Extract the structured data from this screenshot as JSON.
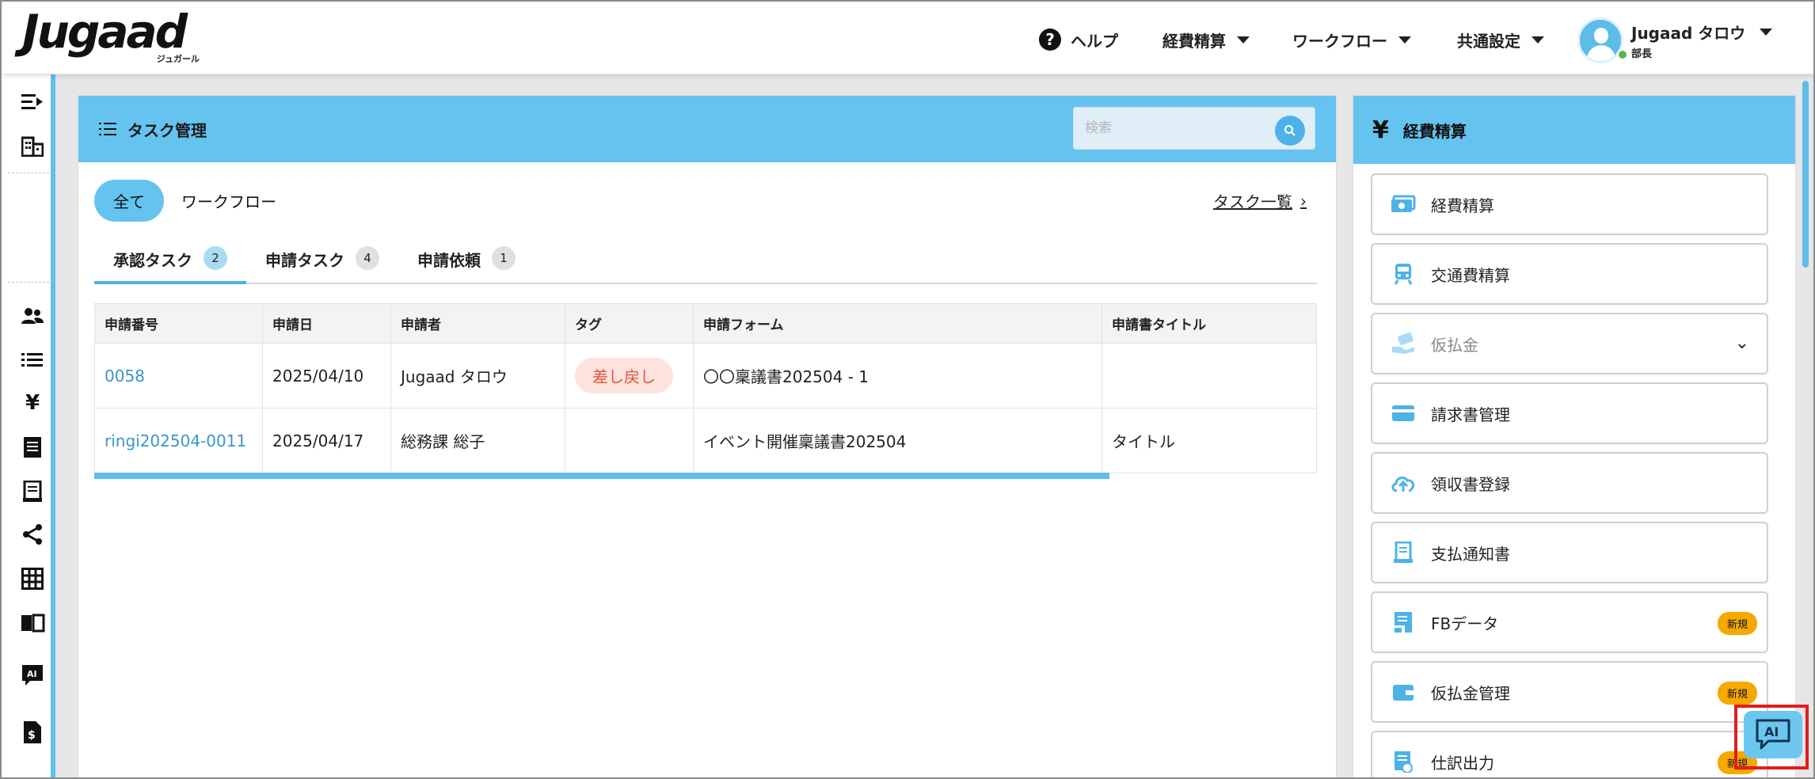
{
  "header": {
    "logo_text": "Jugaad",
    "logo_sub": "ジュガール",
    "nav": [
      {
        "label": "ヘルプ"
      },
      {
        "label": "経費精算"
      },
      {
        "label": "ワークフロー"
      },
      {
        "label": "共通設定"
      }
    ],
    "user": {
      "name": "Jugaad タロウ",
      "role": "部長"
    }
  },
  "sidebar": {
    "icons": [
      "collapse-menu-icon",
      "building-icon",
      "users-icon",
      "list-icon",
      "yen-icon",
      "document-icon",
      "receipt-icon",
      "share-icon",
      "grid-icon",
      "book-icon",
      "ai-chat-icon",
      "invoice-dollar-icon"
    ]
  },
  "task": {
    "title": "タスク管理",
    "search_placeholder": "検索",
    "filters": [
      "全て",
      "ワークフロー"
    ],
    "task_list_link": "タスク一覧",
    "subtabs": [
      {
        "label": "承認タスク",
        "count": "2"
      },
      {
        "label": "申請タスク",
        "count": "4"
      },
      {
        "label": "申請依頼",
        "count": "1"
      }
    ],
    "columns": [
      "申請番号",
      "申請日",
      "申請者",
      "タグ",
      "申請フォーム",
      "申請書タイトル"
    ],
    "rows": [
      {
        "number": "0058",
        "date": "2025/04/10",
        "applicant": "Jugaad タロウ",
        "tag": "差し戻し",
        "form": "〇〇稟議書202504 - 1",
        "title": ""
      },
      {
        "number": "ringi202504-0011",
        "date": "2025/04/17",
        "applicant": "総務課 総子",
        "tag": "",
        "form": "イベント開催稟議書202504",
        "title": "タイトル"
      }
    ]
  },
  "expense": {
    "title": "経費精算",
    "items": [
      {
        "label": "経費精算",
        "icon": "money-icon"
      },
      {
        "label": "交通費精算",
        "icon": "train-icon"
      },
      {
        "label": "仮払金",
        "icon": "hand-money-icon"
      },
      {
        "label": "請求書管理",
        "icon": "credit-card-icon"
      },
      {
        "label": "領収書登録",
        "icon": "cloud-upload-icon"
      },
      {
        "label": "支払通知書",
        "icon": "receipt-icon"
      },
      {
        "label": "FBデータ",
        "icon": "fb-data-icon",
        "badge": "新規"
      },
      {
        "label": "仮払金管理",
        "icon": "wallet-icon",
        "badge": "新規"
      },
      {
        "label": "仕訳出力",
        "icon": "journal-export-icon",
        "badge": "新規"
      }
    ]
  },
  "ai_button": {
    "label": "AI"
  },
  "colors": {
    "accent": "#65c3f0",
    "link": "#3a95c9",
    "tag_bg": "#fde2dd",
    "tag_text": "#e5533d",
    "badge": "#f6a800",
    "highlight": "#e21d1d"
  }
}
